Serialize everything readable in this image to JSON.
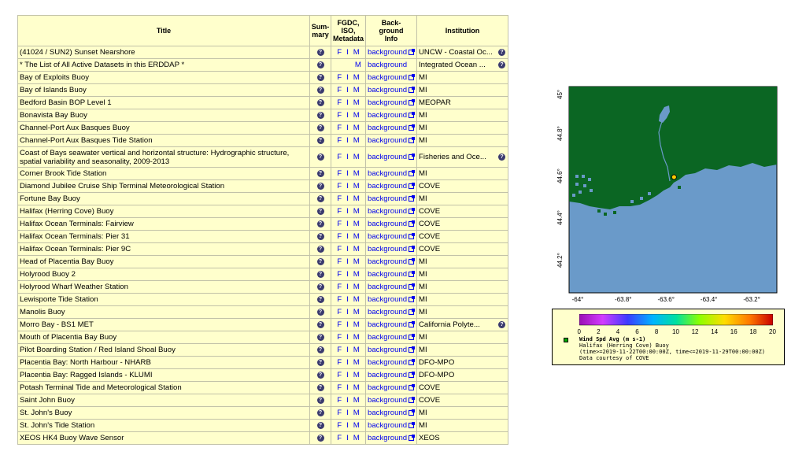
{
  "table": {
    "headers": {
      "title": "Title",
      "summary": "Sum-\nmary",
      "metadata": "FGDC,\nISO,\nMetadata",
      "background": "Back-\nground\nInfo",
      "institution": "Institution"
    },
    "summary_icon": "?",
    "links": {
      "f": "F",
      "i": "I",
      "m": "M"
    },
    "rows": [
      {
        "title": "(41024 / SUN2) Sunset Nearshore",
        "fim": "FIM",
        "background": "background",
        "ext": true,
        "institution": "UNCW - Coastal Oc...",
        "inst_info": true
      },
      {
        "title": "* The List of All Active Datasets in this ERDDAP *",
        "fim": "M",
        "background": "background",
        "ext": false,
        "institution": "Integrated Ocean ...",
        "inst_info": true
      },
      {
        "title": "Bay of Exploits Buoy",
        "fim": "FIM",
        "background": "background",
        "ext": true,
        "institution": "MI",
        "inst_info": false
      },
      {
        "title": "Bay of Islands Buoy",
        "fim": "FIM",
        "background": "background",
        "ext": true,
        "institution": "MI",
        "inst_info": false
      },
      {
        "title": "Bedford Basin BOP Level 1",
        "fim": "FIM",
        "background": "background",
        "ext": true,
        "institution": "MEOPAR",
        "inst_info": false
      },
      {
        "title": "Bonavista Bay Buoy",
        "fim": "FIM",
        "background": "background",
        "ext": true,
        "institution": "MI",
        "inst_info": false
      },
      {
        "title": "Channel-Port Aux Basques Buoy",
        "fim": "FIM",
        "background": "background",
        "ext": true,
        "institution": "MI",
        "inst_info": false
      },
      {
        "title": "Channel-Port Aux Basques Tide Station",
        "fim": "FIM",
        "background": "background",
        "ext": true,
        "institution": "MI",
        "inst_info": false
      },
      {
        "title": "Coast of Bays seawater vertical and horizontal structure: Hydrographic structure, spatial variability and seasonality, 2009-2013",
        "fim": "FIM",
        "background": "background",
        "ext": true,
        "institution": "Fisheries and Oce...",
        "inst_info": true,
        "tall": true
      },
      {
        "title": "Corner Brook Tide Station",
        "fim": "FIM",
        "background": "background",
        "ext": true,
        "institution": "MI",
        "inst_info": false
      },
      {
        "title": "Diamond Jubilee Cruise Ship Terminal Meteorological Station",
        "fim": "FIM",
        "background": "background",
        "ext": true,
        "institution": "COVE",
        "inst_info": false
      },
      {
        "title": "Fortune Bay Buoy",
        "fim": "FIM",
        "background": "background",
        "ext": true,
        "institution": "MI",
        "inst_info": false
      },
      {
        "title": "Halifax (Herring Cove) Buoy",
        "fim": "FIM",
        "background": "background",
        "ext": true,
        "institution": "COVE",
        "inst_info": false
      },
      {
        "title": "Halifax Ocean Terminals: Fairview",
        "fim": "FIM",
        "background": "background",
        "ext": true,
        "institution": "COVE",
        "inst_info": false
      },
      {
        "title": "Halifax Ocean Terminals: Pier 31",
        "fim": "FIM",
        "background": "background",
        "ext": true,
        "institution": "COVE",
        "inst_info": false
      },
      {
        "title": "Halifax Ocean Terminals: Pier 9C",
        "fim": "FIM",
        "background": "background",
        "ext": true,
        "institution": "COVE",
        "inst_info": false
      },
      {
        "title": "Head of Placentia Bay Buoy",
        "fim": "FIM",
        "background": "background",
        "ext": true,
        "institution": "MI",
        "inst_info": false
      },
      {
        "title": "Holyrood Buoy 2",
        "fim": "FIM",
        "background": "background",
        "ext": true,
        "institution": "MI",
        "inst_info": false
      },
      {
        "title": "Holyrood Wharf Weather Station",
        "fim": "FIM",
        "background": "background",
        "ext": true,
        "institution": "MI",
        "inst_info": false
      },
      {
        "title": "Lewisporte Tide Station",
        "fim": "FIM",
        "background": "background",
        "ext": true,
        "institution": "MI",
        "inst_info": false
      },
      {
        "title": "Manolis Buoy",
        "fim": "FIM",
        "background": "background",
        "ext": true,
        "institution": "MI",
        "inst_info": false
      },
      {
        "title": "Morro Bay - BS1 MET",
        "fim": "FIM",
        "background": "background",
        "ext": true,
        "institution": "California Polyte...",
        "inst_info": true
      },
      {
        "title": "Mouth of Placentia Bay Buoy",
        "fim": "FIM",
        "background": "background",
        "ext": true,
        "institution": "MI",
        "inst_info": false
      },
      {
        "title": "Pilot Boarding Station / Red Island Shoal Buoy",
        "fim": "FIM",
        "background": "background",
        "ext": true,
        "institution": "MI",
        "inst_info": false
      },
      {
        "title": "Placentia Bay: North Harbour - NHARB",
        "fim": "FIM",
        "background": "background",
        "ext": true,
        "institution": "DFO-MPO",
        "inst_info": false
      },
      {
        "title": "Placentia Bay: Ragged Islands - KLUMI",
        "fim": "FIM",
        "background": "background",
        "ext": true,
        "institution": "DFO-MPO",
        "inst_info": false
      },
      {
        "title": "Potash Terminal Tide and Meteorological Station",
        "fim": "FIM",
        "background": "background",
        "ext": true,
        "institution": "COVE",
        "inst_info": false
      },
      {
        "title": "Saint John Buoy",
        "fim": "FIM",
        "background": "background",
        "ext": true,
        "institution": "COVE",
        "inst_info": false
      },
      {
        "title": "St. John's Buoy",
        "fim": "FIM",
        "background": "background",
        "ext": true,
        "institution": "MI",
        "inst_info": false
      },
      {
        "title": "St. John's Tide Station",
        "fim": "FIM",
        "background": "background",
        "ext": true,
        "institution": "MI",
        "inst_info": false
      },
      {
        "title": "XEOS HK4 Buoy Wave Sensor",
        "fim": "FIM",
        "background": "background",
        "ext": true,
        "institution": "XEOS",
        "inst_info": false
      }
    ]
  },
  "map": {
    "land_color": "#0b6623",
    "water_color": "#6a9ac9",
    "station_color": "#ffcc00",
    "y_ticks": [
      "45°",
      "44.8°",
      "44.6°",
      "44.4°",
      "44.2°"
    ],
    "x_ticks": [
      "-64°",
      "-63.8°",
      "-63.6°",
      "-63.4°",
      "-63.2°"
    ],
    "station_lon": -63.56,
    "station_lat": 44.6
  },
  "legend": {
    "colorbar_ticks": [
      "0",
      "2",
      "4",
      "6",
      "8",
      "10",
      "12",
      "14",
      "16",
      "18",
      "20"
    ],
    "colorbar_range": [
      0,
      20
    ],
    "marker_color": "#00aa00",
    "variable": "Wind Spd Avg (m s-1)",
    "dataset": "Halifax (Herring Cove) Buoy",
    "time_constraint": "(time>=2019-11-22T00:00:00Z, time<=2019-11-29T00:00:00Z)",
    "credit": "Data courtesy of COVE"
  }
}
